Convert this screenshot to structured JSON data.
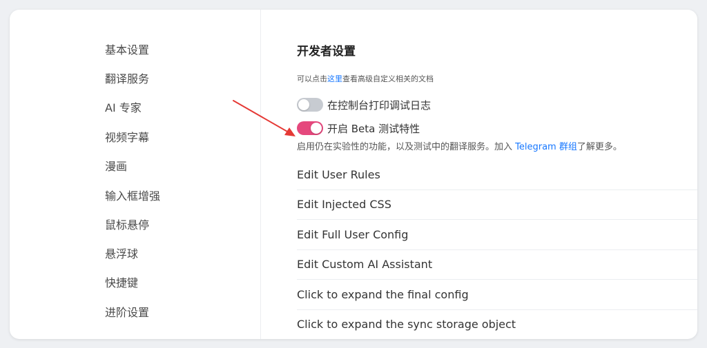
{
  "sidebar": {
    "items": [
      {
        "label": "基本设置"
      },
      {
        "label": "翻译服务"
      },
      {
        "label": "AI 专家"
      },
      {
        "label": "视频字幕"
      },
      {
        "label": "漫画"
      },
      {
        "label": "输入框增强"
      },
      {
        "label": "鼠标悬停"
      },
      {
        "label": "悬浮球"
      },
      {
        "label": "快捷键"
      },
      {
        "label": "进阶设置"
      }
    ]
  },
  "main": {
    "title": "开发者设置",
    "doc_hint_prefix": "可以点击",
    "doc_hint_link": "这里",
    "doc_hint_suffix": "查看高级自定义相关的文档",
    "debug_toggle": {
      "label": "在控制台打印调试日志",
      "state": "off"
    },
    "beta_toggle": {
      "label": "开启 Beta 测试特性",
      "state": "on"
    },
    "beta_desc_prefix": "启用仍在实验性的功能，以及测试中的翻译服务。加入 ",
    "beta_desc_link": "Telegram 群组",
    "beta_desc_suffix": "了解更多。",
    "actions": [
      {
        "label": "Edit User Rules"
      },
      {
        "label": "Edit Injected CSS"
      },
      {
        "label": "Edit Full User Config"
      },
      {
        "label": "Edit Custom AI Assistant"
      },
      {
        "label": "Click to expand the final config"
      },
      {
        "label": "Click to expand the sync storage object"
      }
    ]
  },
  "colors": {
    "accent_link": "#1677ff",
    "toggle_on": "#e5487d",
    "toggle_off": "#c7cbd1",
    "annotation_arrow": "#e53935"
  }
}
